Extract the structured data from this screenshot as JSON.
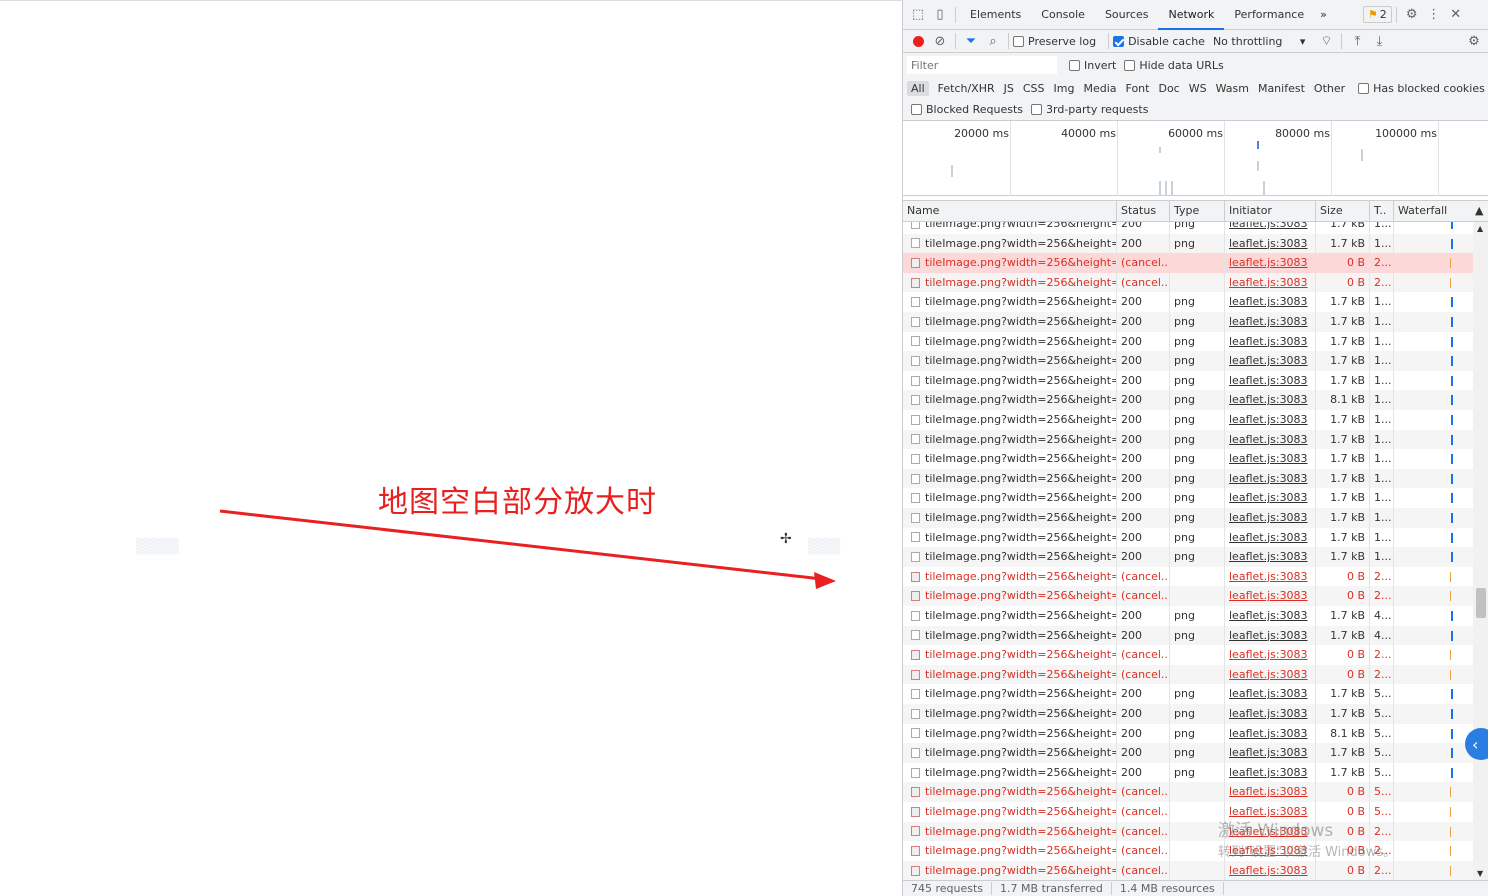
{
  "map": {
    "annotation": "地图空白部分放大时",
    "colors": {
      "annotation": "#e8201f",
      "arrow": "#e8201f"
    }
  },
  "devtools": {
    "tabs": [
      "Elements",
      "Console",
      "Sources",
      "Network",
      "Performance"
    ],
    "active_tab": "Network",
    "more_tabs": "»",
    "issues_count": "2",
    "toolbar": {
      "preserve_log": "Preserve log",
      "disable_cache": "Disable cache",
      "throttling": "No throttling"
    },
    "filter": {
      "placeholder": "Filter",
      "invert": "Invert",
      "hide_data_urls": "Hide data URLs"
    },
    "types": [
      "All",
      "Fetch/XHR",
      "JS",
      "CSS",
      "Img",
      "Media",
      "Font",
      "Doc",
      "WS",
      "Wasm",
      "Manifest",
      "Other"
    ],
    "has_blocked_cookies": "Has blocked cookies",
    "blocked_requests": "Blocked Requests",
    "third_party": "3rd-party requests",
    "overview_ticks": [
      "20000 ms",
      "40000 ms",
      "60000 ms",
      "80000 ms",
      "100000 ms"
    ],
    "columns": {
      "name": "Name",
      "status": "Status",
      "type": "Type",
      "initiator": "Initiator",
      "size": "Size",
      "time": "T..",
      "waterfall": "Waterfall"
    },
    "rows": [
      {
        "name": "tileImage.png?width=256&height=...",
        "status": "200",
        "type": "png",
        "initiator": "leaflet.js:3083",
        "size": "1.7 kB",
        "time": "1...",
        "err": false
      },
      {
        "name": "tileImage.png?width=256&height=...",
        "status": "200",
        "type": "png",
        "initiator": "leaflet.js:3083",
        "size": "1.7 kB",
        "time": "1...",
        "err": false
      },
      {
        "name": "tileImage.png?width=256&height=...",
        "status": "(cancel...",
        "type": "",
        "initiator": "leaflet.js:3083",
        "size": "0 B",
        "time": "2...",
        "err": true
      },
      {
        "name": "tileImage.png?width=256&height=...",
        "status": "(cancel...",
        "type": "",
        "initiator": "leaflet.js:3083",
        "size": "0 B",
        "time": "2...",
        "err": true
      },
      {
        "name": "tileImage.png?width=256&height=...",
        "status": "200",
        "type": "png",
        "initiator": "leaflet.js:3083",
        "size": "1.7 kB",
        "time": "1...",
        "err": false
      },
      {
        "name": "tileImage.png?width=256&height=...",
        "status": "200",
        "type": "png",
        "initiator": "leaflet.js:3083",
        "size": "1.7 kB",
        "time": "1...",
        "err": false
      },
      {
        "name": "tileImage.png?width=256&height=...",
        "status": "200",
        "type": "png",
        "initiator": "leaflet.js:3083",
        "size": "1.7 kB",
        "time": "1...",
        "err": false
      },
      {
        "name": "tileImage.png?width=256&height=...",
        "status": "200",
        "type": "png",
        "initiator": "leaflet.js:3083",
        "size": "1.7 kB",
        "time": "1...",
        "err": false
      },
      {
        "name": "tileImage.png?width=256&height=...",
        "status": "200",
        "type": "png",
        "initiator": "leaflet.js:3083",
        "size": "1.7 kB",
        "time": "1...",
        "err": false
      },
      {
        "name": "tileImage.png?width=256&height=...",
        "status": "200",
        "type": "png",
        "initiator": "leaflet.js:3083",
        "size": "8.1 kB",
        "time": "1...",
        "err": false
      },
      {
        "name": "tileImage.png?width=256&height=...",
        "status": "200",
        "type": "png",
        "initiator": "leaflet.js:3083",
        "size": "1.7 kB",
        "time": "1...",
        "err": false
      },
      {
        "name": "tileImage.png?width=256&height=...",
        "status": "200",
        "type": "png",
        "initiator": "leaflet.js:3083",
        "size": "1.7 kB",
        "time": "1...",
        "err": false
      },
      {
        "name": "tileImage.png?width=256&height=...",
        "status": "200",
        "type": "png",
        "initiator": "leaflet.js:3083",
        "size": "1.7 kB",
        "time": "1...",
        "err": false
      },
      {
        "name": "tileImage.png?width=256&height=...",
        "status": "200",
        "type": "png",
        "initiator": "leaflet.js:3083",
        "size": "1.7 kB",
        "time": "1...",
        "err": false
      },
      {
        "name": "tileImage.png?width=256&height=...",
        "status": "200",
        "type": "png",
        "initiator": "leaflet.js:3083",
        "size": "1.7 kB",
        "time": "1...",
        "err": false
      },
      {
        "name": "tileImage.png?width=256&height=...",
        "status": "200",
        "type": "png",
        "initiator": "leaflet.js:3083",
        "size": "1.7 kB",
        "time": "1...",
        "err": false
      },
      {
        "name": "tileImage.png?width=256&height=...",
        "status": "200",
        "type": "png",
        "initiator": "leaflet.js:3083",
        "size": "1.7 kB",
        "time": "1...",
        "err": false
      },
      {
        "name": "tileImage.png?width=256&height=...",
        "status": "200",
        "type": "png",
        "initiator": "leaflet.js:3083",
        "size": "1.7 kB",
        "time": "1...",
        "err": false
      },
      {
        "name": "tileImage.png?width=256&height=...",
        "status": "(cancel...",
        "type": "",
        "initiator": "leaflet.js:3083",
        "size": "0 B",
        "time": "2...",
        "err": true
      },
      {
        "name": "tileImage.png?width=256&height=...",
        "status": "(cancel...",
        "type": "",
        "initiator": "leaflet.js:3083",
        "size": "0 B",
        "time": "2...",
        "err": true
      },
      {
        "name": "tileImage.png?width=256&height=...",
        "status": "200",
        "type": "png",
        "initiator": "leaflet.js:3083",
        "size": "1.7 kB",
        "time": "4...",
        "err": false
      },
      {
        "name": "tileImage.png?width=256&height=...",
        "status": "200",
        "type": "png",
        "initiator": "leaflet.js:3083",
        "size": "1.7 kB",
        "time": "4...",
        "err": false
      },
      {
        "name": "tileImage.png?width=256&height=...",
        "status": "(cancel...",
        "type": "",
        "initiator": "leaflet.js:3083",
        "size": "0 B",
        "time": "2...",
        "err": true
      },
      {
        "name": "tileImage.png?width=256&height=...",
        "status": "(cancel...",
        "type": "",
        "initiator": "leaflet.js:3083",
        "size": "0 B",
        "time": "2...",
        "err": true
      },
      {
        "name": "tileImage.png?width=256&height=...",
        "status": "200",
        "type": "png",
        "initiator": "leaflet.js:3083",
        "size": "1.7 kB",
        "time": "5...",
        "err": false
      },
      {
        "name": "tileImage.png?width=256&height=...",
        "status": "200",
        "type": "png",
        "initiator": "leaflet.js:3083",
        "size": "1.7 kB",
        "time": "5...",
        "err": false
      },
      {
        "name": "tileImage.png?width=256&height=...",
        "status": "200",
        "type": "png",
        "initiator": "leaflet.js:3083",
        "size": "8.1 kB",
        "time": "5...",
        "err": false
      },
      {
        "name": "tileImage.png?width=256&height=...",
        "status": "200",
        "type": "png",
        "initiator": "leaflet.js:3083",
        "size": "1.7 kB",
        "time": "5...",
        "err": false
      },
      {
        "name": "tileImage.png?width=256&height=...",
        "status": "200",
        "type": "png",
        "initiator": "leaflet.js:3083",
        "size": "1.7 kB",
        "time": "5...",
        "err": false
      },
      {
        "name": "tileImage.png?width=256&height=...",
        "status": "(cancel...",
        "type": "",
        "initiator": "leaflet.js:3083",
        "size": "0 B",
        "time": "5...",
        "err": true
      },
      {
        "name": "tileImage.png?width=256&height=...",
        "status": "(cancel...",
        "type": "",
        "initiator": "leaflet.js:3083",
        "size": "0 B",
        "time": "5...",
        "err": true
      },
      {
        "name": "tileImage.png?width=256&height=...",
        "status": "(cancel...",
        "type": "",
        "initiator": "leaflet.js:3083",
        "size": "0 B",
        "time": "2...",
        "err": true
      },
      {
        "name": "tileImage.png?width=256&height=...",
        "status": "(cancel...",
        "type": "",
        "initiator": "leaflet.js:3083",
        "size": "0 B",
        "time": "2...",
        "err": true
      },
      {
        "name": "tileImage.png?width=256&height=...",
        "status": "(cancel...",
        "type": "",
        "initiator": "leaflet.js:3083",
        "size": "0 B",
        "time": "2...",
        "err": true
      }
    ],
    "status_bar": [
      "745 requests",
      "1.7 MB transferred",
      "1.4 MB resources"
    ],
    "colors": {
      "accent": "#1a73e8",
      "error": "#d93025",
      "selected_row": "#fcd8d8",
      "record": "#e8201f"
    }
  },
  "watermark": {
    "line1": "激活 Windows",
    "line2": "转到\"设置\"以激活 Windows。"
  }
}
